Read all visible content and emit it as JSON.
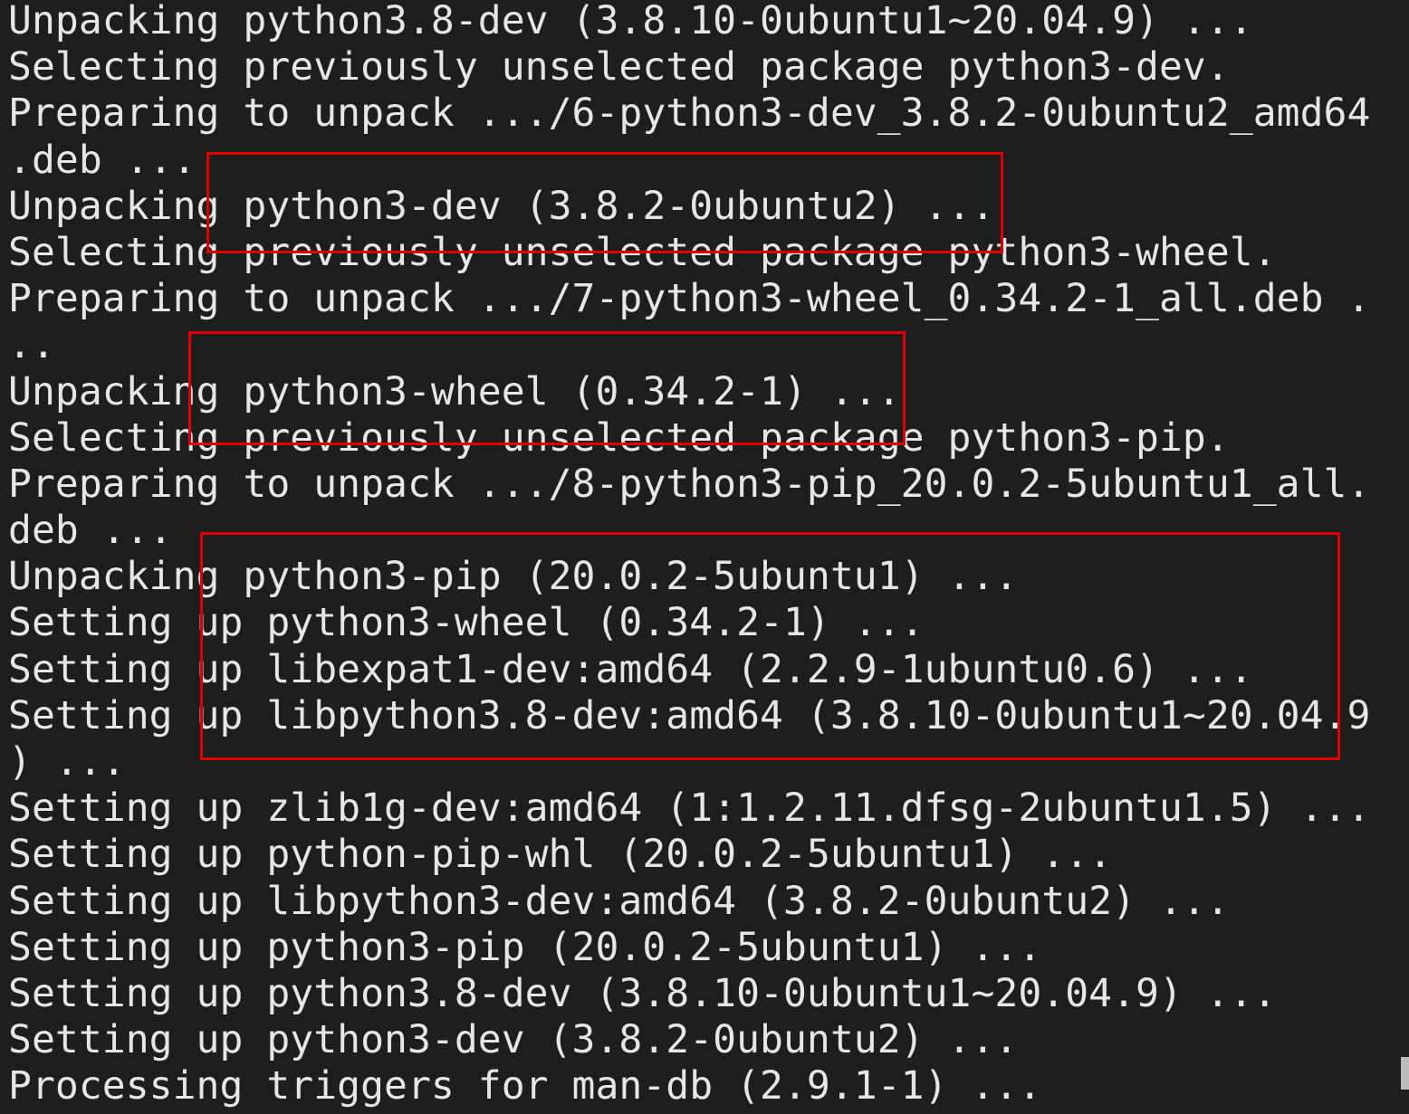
{
  "terminal": {
    "lines": [
      "Unpacking python3.8-dev (3.8.10-0ubuntu1~20.04.9) ...",
      "Selecting previously unselected package python3-dev.",
      "Preparing to unpack .../6-python3-dev_3.8.2-0ubuntu2_amd64",
      ".deb ...",
      "Unpacking python3-dev (3.8.2-0ubuntu2) ...",
      "Selecting previously unselected package python3-wheel.",
      "Preparing to unpack .../7-python3-wheel_0.34.2-1_all.deb .",
      "..",
      "Unpacking python3-wheel (0.34.2-1) ...",
      "Selecting previously unselected package python3-pip.",
      "Preparing to unpack .../8-python3-pip_20.0.2-5ubuntu1_all.",
      "deb ...",
      "Unpacking python3-pip (20.0.2-5ubuntu1) ...",
      "Setting up python3-wheel (0.34.2-1) ...",
      "Setting up libexpat1-dev:amd64 (2.2.9-1ubuntu0.6) ...",
      "Setting up libpython3.8-dev:amd64 (3.8.10-0ubuntu1~20.04.9",
      ") ...",
      "Setting up zlib1g-dev:amd64 (1:1.2.11.dfsg-2ubuntu1.5) ...",
      "Setting up python-pip-whl (20.0.2-5ubuntu1) ...",
      "Setting up libpython3-dev:amd64 (3.8.2-0ubuntu2) ...",
      "Setting up python3-pip (20.0.2-5ubuntu1) ...",
      "Setting up python3.8-dev (3.8.10-0ubuntu1~20.04.9) ...",
      "Setting up python3-dev (3.8.2-0ubuntu2) ...",
      "Processing triggers for man-db (2.9.1-1) ..."
    ]
  },
  "colors": {
    "background": "#1e1e1e",
    "text": "#e6e6e6",
    "highlight": "#e00000"
  }
}
